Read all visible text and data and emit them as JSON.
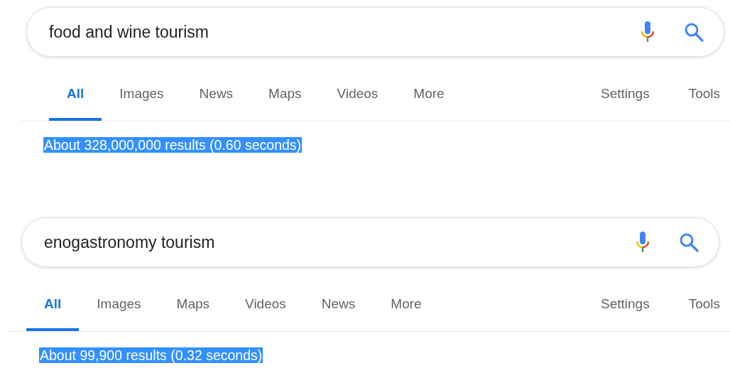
{
  "panels": [
    {
      "query": "food and wine tourism",
      "tabs": [
        {
          "label": "All",
          "selected": true
        },
        {
          "label": "Images",
          "selected": false
        },
        {
          "label": "News",
          "selected": false
        },
        {
          "label": "Maps",
          "selected": false
        },
        {
          "label": "Videos",
          "selected": false
        },
        {
          "label": "More",
          "selected": false
        }
      ],
      "right_tabs": [
        "Settings",
        "Tools"
      ],
      "result_stats": {
        "text": "About 328,000,000 results (0.60 seconds)",
        "highlighted": true
      }
    },
    {
      "query": "enogastronomy tourism",
      "tabs": [
        {
          "label": "All",
          "selected": true
        },
        {
          "label": "Images",
          "selected": false
        },
        {
          "label": "Maps",
          "selected": false
        },
        {
          "label": "Videos",
          "selected": false
        },
        {
          "label": "News",
          "selected": false
        },
        {
          "label": "More",
          "selected": false
        }
      ],
      "right_tabs": [
        "Settings",
        "Tools"
      ],
      "result_stats": {
        "text": "About 99,900 results (0.32 seconds)",
        "highlighted": true
      }
    }
  ]
}
